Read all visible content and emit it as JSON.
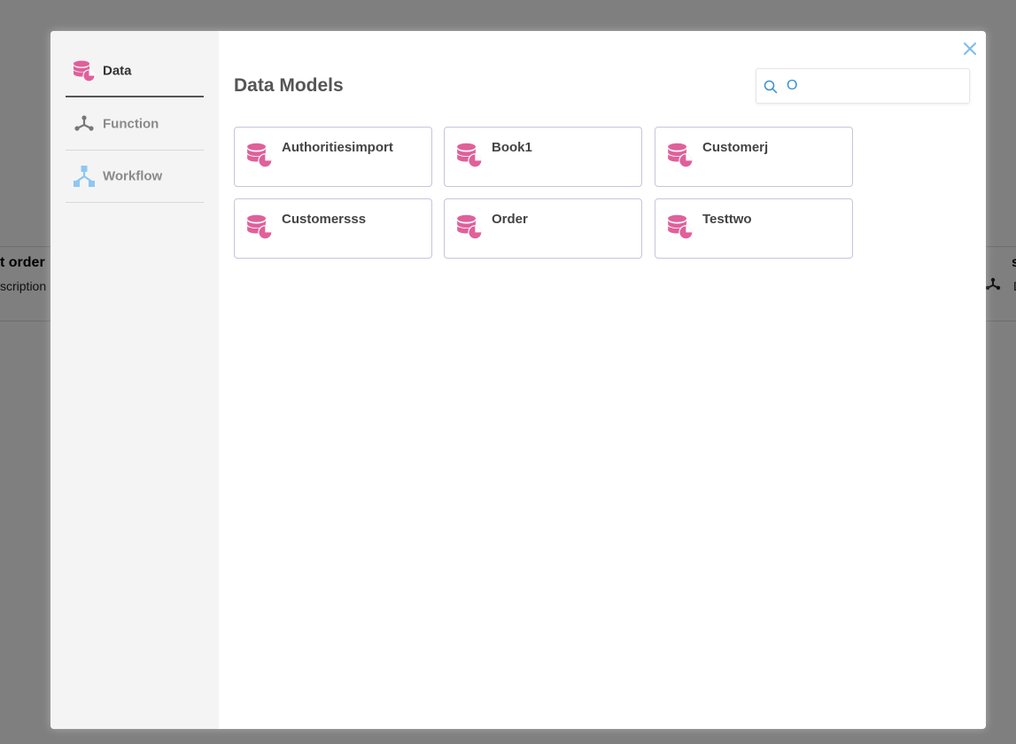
{
  "background": {
    "left_card": {
      "title": "t order",
      "description": "scription"
    },
    "right_card": {
      "title": "s",
      "description": "D"
    }
  },
  "sidebar": {
    "items": [
      {
        "label": "Data",
        "icon": "database-chart-icon",
        "active": true
      },
      {
        "label": "Function",
        "icon": "function-icon",
        "active": false
      },
      {
        "label": "Workflow",
        "icon": "workflow-icon",
        "active": false
      }
    ]
  },
  "main": {
    "title": "Data Models",
    "search": {
      "value": "O",
      "placeholder": ""
    },
    "cards": [
      {
        "label": "Authoritiesimport",
        "icon": "database-chart-icon"
      },
      {
        "label": "Book1",
        "icon": "database-chart-icon"
      },
      {
        "label": "Customerj",
        "icon": "database-chart-icon"
      },
      {
        "label": "Customersss",
        "icon": "database-chart-icon"
      },
      {
        "label": "Order",
        "icon": "database-chart-icon"
      },
      {
        "label": "Testtwo",
        "icon": "database-chart-icon"
      }
    ]
  },
  "colors": {
    "accent_pink": "#e0609a",
    "workflow_blue": "#8ec7f2",
    "close_blue": "#7cbcea",
    "card_border": "#c9c3dc"
  }
}
